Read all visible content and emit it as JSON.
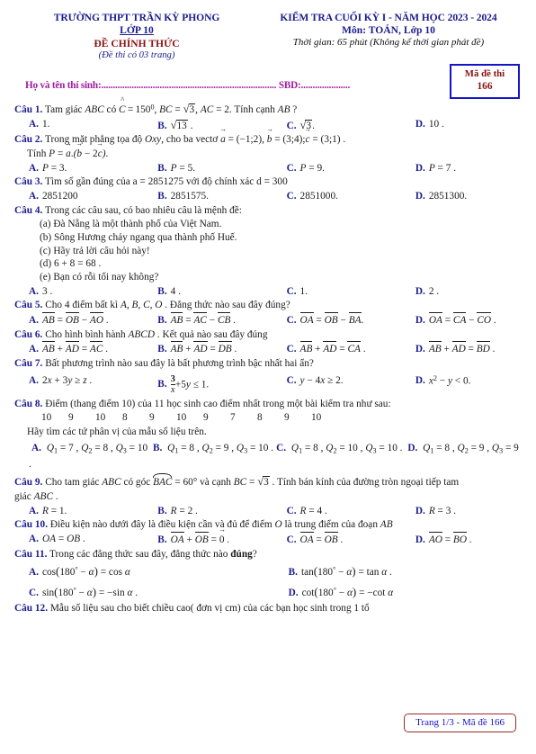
{
  "header": {
    "school": "TRƯỜNG THPT TRẦN KỲ PHONG",
    "grade": "LỚP 10",
    "official": "ĐỀ CHÍNH THỨC",
    "pages_note": "(Đề thi có 03 trang)",
    "exam_title": "KIỂM TRA CUỐI KỲ I - NĂM HỌC 2023 - 2024",
    "subject": "Môn: TOÁN, Lớp 10",
    "duration": "Thời gian: 65 phút (Không kể thời gian phát đề)",
    "name_field": "Họ và tên thí sinh:........................................................................... SBD:.....................",
    "code_label": "Mã đề thi",
    "code_value": "166"
  },
  "colors": {
    "heading_blue": "#1b1b8f",
    "official_red": "#8a1010",
    "name_purple": "#a01ca0",
    "code_border": "#1414c8",
    "footer_border": "#9d2a2a"
  },
  "questions": [
    {
      "label": "Câu 1.",
      "stem_pre": "Tam giác ",
      "text": "Tam giác ABC có Ĉ = 150°, BC = √3, AC = 2. Tính cạnh AB ?",
      "options": [
        "1.",
        "√13 .",
        "√3.",
        "10 ."
      ]
    },
    {
      "label": "Câu 2.",
      "text": "Trong mặt phẳng tọa độ Oxy, cho ba vectơ a⃗ = (−1;2), b⃗ = (3;4); c⃗ = (3;1).",
      "line2": "Tính P = a⃗.(b⃗ − 2c⃗).",
      "options": [
        "P = 3.",
        "P = 5.",
        "P = 9.",
        "P = 7."
      ]
    },
    {
      "label": "Câu 3.",
      "text": "Tìm số gần đúng của a = 2851275 với độ chính xác d = 300",
      "options": [
        "2851200",
        "2851575.",
        "2851000.",
        "2851300."
      ]
    },
    {
      "label": "Câu 4.",
      "text": "Trong các câu sau, có bao nhiêu câu là mệnh đề:",
      "items": [
        "(a) Đà Nẵng là một thành phố của Việt Nam.",
        "(b) Sông Hương chảy ngang qua thành phố Huế.",
        "(c) Hãy trả lời câu hỏi này!",
        "(d) 6 + 8 = 68 .",
        "(e) Bạn có rỗi tối nay không?"
      ],
      "options": [
        "3 .",
        "4 .",
        "1.",
        "2 ."
      ]
    },
    {
      "label": "Câu 5.",
      "text": "Cho 4 điểm bất kì A, B, C, O . Đẳng thức nào sau đây đúng?",
      "options": [
        "AB = OB − AO .",
        "AB = AC − CB .",
        "OA = OB − BA.",
        "OA = CA − CO ."
      ]
    },
    {
      "label": "Câu 6.",
      "text": "Cho hình bình hành ABCD . Kết quả nào sau đây đúng",
      "options": [
        "AB + AD = AC .",
        "AB + AD = DB .",
        "AB + AD = CA .",
        "AB + AD = BD ."
      ]
    },
    {
      "label": "Câu 7.",
      "text": "Bất phương trình nào sau đây là bất phương trình bậc nhất hai ẩn?",
      "options": [
        "2x + 3y ≥ z .",
        "3/x + 5y ≤ 1.",
        "y − 4x ≥ 2.",
        "x² − y < 0."
      ]
    },
    {
      "label": "Câu 8.",
      "text": "Điểm (thang điểm 10) của 11 học sinh cao điểm nhất trong một bài kiểm tra như sau:",
      "data_values": [
        "10",
        "9",
        "10",
        "8",
        "9",
        "10",
        "9",
        "7",
        "8",
        "9",
        "10"
      ],
      "line2": "Hãy tìm các tứ phân vị của mẫu số liệu trên.",
      "options": [
        "Q1 = 7 , Q2 = 8 , Q3 = 10",
        "Q1 = 8 , Q2 = 9 , Q3 = 10 .",
        "Q1 = 8 , Q2 = 10 , Q3 = 10 .",
        "Q1 = 8 , Q2 = 9 , Q3 = 9 ."
      ]
    },
    {
      "label": "Câu 9.",
      "text": "Cho tam giác ABC có góc BAC = 60° và cạnh BC = √3 . Tính bán kính của đường tròn ngoại tiếp tam",
      "line2": "giác ABC .",
      "options": [
        "R = 1.",
        "R = 2 .",
        "R = 4 .",
        "R = 3 ."
      ]
    },
    {
      "label": "Câu 10.",
      "text": "Điều kiện nào dưới đây là điều kiện cần và đủ để điểm O là trung điểm của đoạn AB",
      "options": [
        "OA = OB .",
        "OA + OB = 0⃗ .",
        "OA = OB .",
        "AO = BO ."
      ]
    },
    {
      "label": "Câu 11.",
      "text": "Trong các đẳng thức sau đây, đẳng thức nào đúng?",
      "bold_word": "đúng",
      "options": [
        "cos(180° − α) = cos α",
        "tan(180° − α) = tan α .",
        "sin(180° − α) = −sin α .",
        "cot(180° − α) = −cot α"
      ]
    },
    {
      "label": "Câu 12.",
      "text": "Mẫu số liệu sau cho biết chiều cao( đơn vị cm) của các bạn học sinh trong 1 tổ"
    }
  ],
  "option_letters": [
    "A.",
    "B.",
    "C.",
    "D."
  ],
  "footer": {
    "page_note": "Trang 1/3 - Mã đề 166"
  }
}
